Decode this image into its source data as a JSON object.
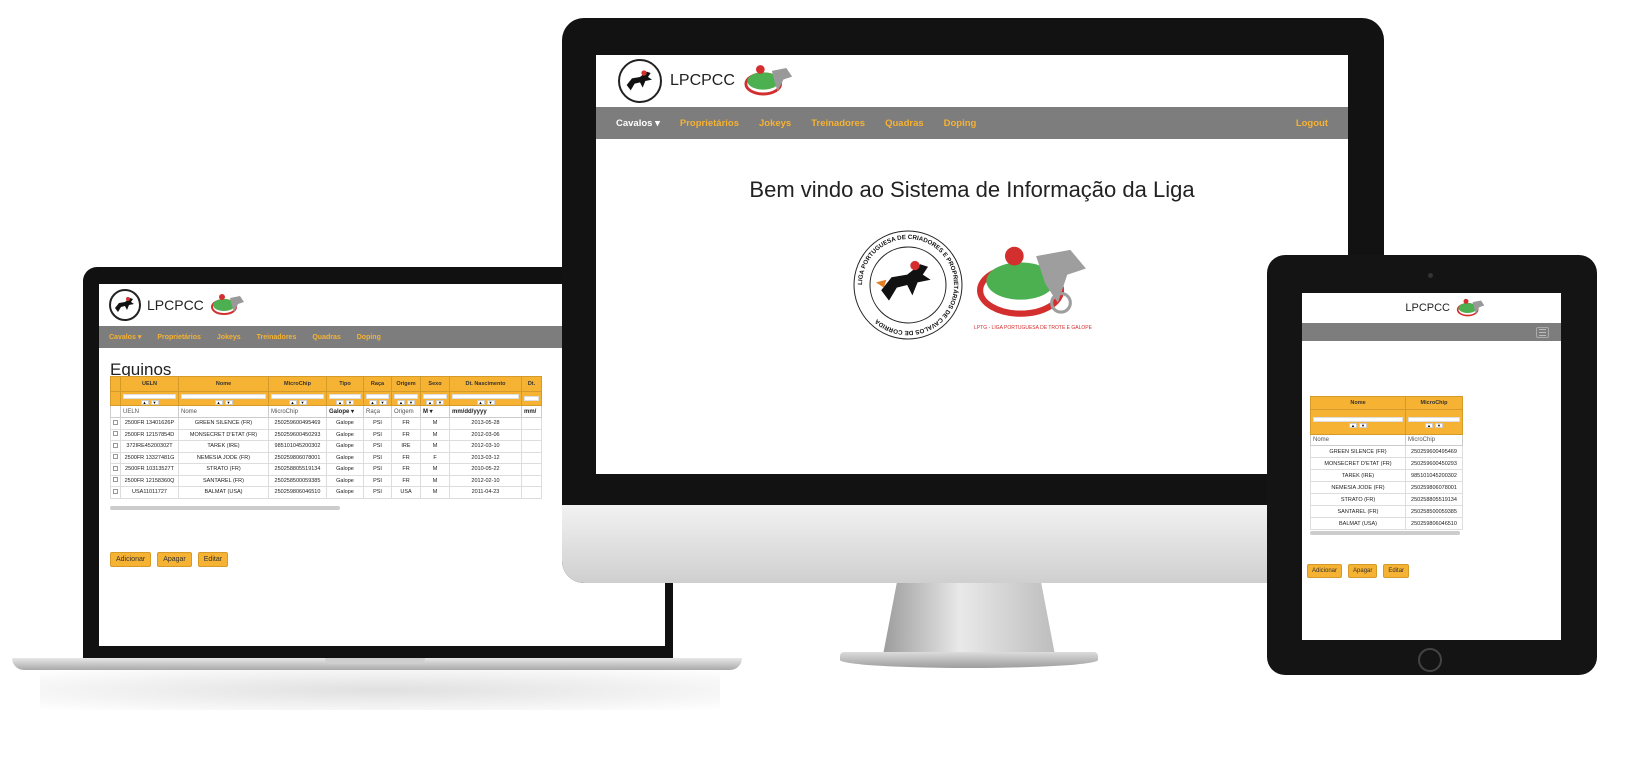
{
  "brand": "LPCPCC",
  "nav": {
    "items": [
      "Cavalos",
      "Proprietários",
      "Jokeys",
      "Treinadores",
      "Quadras",
      "Doping"
    ],
    "dropdown_caret": "▾",
    "logout": "Logout"
  },
  "monitor": {
    "welcome": "Bem vindo ao Sistema de Informação da Liga",
    "logo1_ring_text": "LIGA PORTUGUESA DE CRIADORES E PROPRIETÁRIOS DE CAVALOS DE CORRIDA",
    "logo2_caption": "LPTG - LIGA PORTUGUESA DE TROTE E GALOPE"
  },
  "laptop": {
    "page_title": "Equinos",
    "columns": [
      "UELN",
      "Nome",
      "MicroChip",
      "Tipo",
      "Raça",
      "Origem",
      "Sexo",
      "Dt. Nascimento",
      "Dt."
    ],
    "filter_hints": [
      "UELN",
      "Nome",
      "MicroChip",
      "Galope",
      "Raça",
      "Origem",
      "M",
      "mm/dd/yyyy",
      "mm/"
    ],
    "rows": [
      [
        "2500FR 13401626P",
        "GREEN SILENCE (FR)",
        "250259600495469",
        "Galope",
        "PSI",
        "FR",
        "M",
        "2013-05-28"
      ],
      [
        "2500FR 12157854D",
        "MONSECRET D'ETAT (FR)",
        "250259600450293",
        "Galope",
        "PSI",
        "FR",
        "M",
        "2012-03-06"
      ],
      [
        "372IRE45200302T",
        "TAREK (IRE)",
        "985101045200302",
        "Galope",
        "PSI",
        "IRE",
        "M",
        "2012-03-10"
      ],
      [
        "2500FR 13327481G",
        "NEMESIA JODE (FR)",
        "250259806078001",
        "Galope",
        "PSI",
        "FR",
        "F",
        "2013-03-12"
      ],
      [
        "2500FR 10313527T",
        "STRATO (FR)",
        "250258805519134",
        "Galope",
        "PSI",
        "FR",
        "M",
        "2010-05-22"
      ],
      [
        "2500FR 12158360Q",
        "SANTAREL (FR)",
        "250258500059385",
        "Galope",
        "PSI",
        "FR",
        "M",
        "2012-02-10"
      ],
      [
        "USA11011727",
        "BALMAT (USA)",
        "250259806046510",
        "Galope",
        "PSI",
        "USA",
        "M",
        "2011-04-23"
      ]
    ],
    "buttons": [
      "Adicionar",
      "Apagar",
      "Editar"
    ]
  },
  "tablet": {
    "columns": [
      "Nome",
      "MicroChip"
    ],
    "filter_hints": [
      "Nome",
      "MicroChip"
    ],
    "rows": [
      [
        "GREEN SILENCE (FR)",
        "250259600495469"
      ],
      [
        "MONSECRET D'ETAT (FR)",
        "250259600450293"
      ],
      [
        "TAREK (IRE)",
        "985101045200302"
      ],
      [
        "NEMESIA JODE (FR)",
        "250259806078001"
      ],
      [
        "STRATO (FR)",
        "250258805519134"
      ],
      [
        "SANTAREL (FR)",
        "250258500059385"
      ],
      [
        "BALMAT (USA)",
        "250259806046510"
      ]
    ],
    "buttons": [
      "Adicionar",
      "Apagar",
      "Editar"
    ]
  },
  "icons": {
    "search": "search-icon",
    "sort_up": "sort-up-icon",
    "sort_down": "sort-down-icon",
    "menu": "hamburger-menu-icon"
  },
  "colors": {
    "accent": "#f6b232",
    "navbar": "#7d7d7d",
    "nav_active": "#ffffff",
    "logo_green": "#4caf50",
    "logo_red": "#d32f2f"
  }
}
